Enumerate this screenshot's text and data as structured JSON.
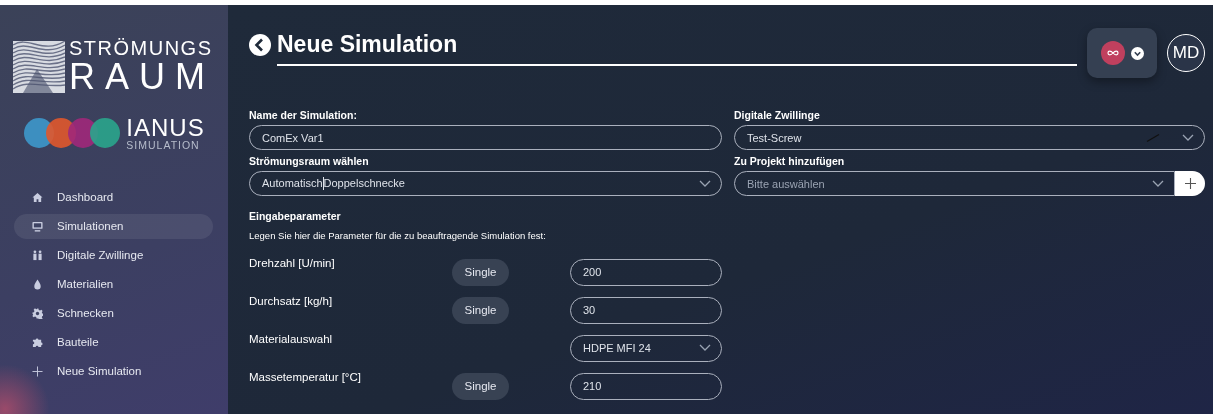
{
  "sidebar": {
    "logo": {
      "line_1": "STRÖMUNGS",
      "line_2": "RAUM"
    },
    "brand": {
      "name": "IANUS",
      "subtitle": "SIMULATION"
    },
    "items": [
      {
        "label": "Dashboard",
        "kind": "home",
        "selected": false
      },
      {
        "label": "Simulationen",
        "kind": "monitor",
        "selected": true
      },
      {
        "label": "Digitale Zwillinge",
        "kind": "people",
        "selected": false
      },
      {
        "label": "Materialien",
        "kind": "drop",
        "selected": false
      },
      {
        "label": "Schnecken",
        "kind": "gear",
        "selected": false
      },
      {
        "label": "Bauteile",
        "kind": "puzzle",
        "selected": false
      },
      {
        "label": "Neue Simulation",
        "kind": "plus",
        "selected": false
      }
    ]
  },
  "header": {
    "title": "Neue Simulation",
    "user_initials": "MD"
  },
  "form": {
    "name": {
      "label": "Name der Simulation:",
      "value": "ComEx Var1"
    },
    "twins": {
      "label": "Digitale Zwillinge",
      "value": "Test-Screw"
    },
    "flow_space": {
      "label": "Strömungsraum wählen",
      "value_1": "Automatisch",
      "value_2": "Doppelschnecke"
    },
    "project": {
      "label": "Zu Projekt hinzufügen",
      "placeholder": "Bitte auswählen"
    },
    "parameters": {
      "title": "Eingabeparameter",
      "hint": "Legen Sie hier die Parameter für die zu beauftragende Simulation fest:",
      "rows": [
        {
          "kind": "number",
          "label": "Drehzahl [U/min]",
          "mode": "Single",
          "value": "200"
        },
        {
          "kind": "number",
          "label": "Durchsatz [kg/h]",
          "mode": "Single",
          "value": "30"
        },
        {
          "kind": "select",
          "label": "Materialauswahl",
          "value": "HDPE MFI 24"
        },
        {
          "kind": "number",
          "label": "Massetemperatur [°C]",
          "mode": "Single",
          "value": "210"
        }
      ]
    }
  }
}
